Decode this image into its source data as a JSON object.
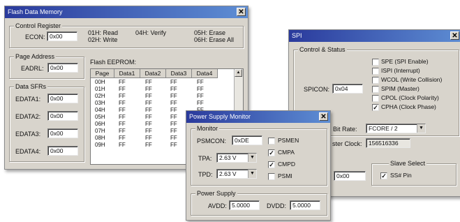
{
  "flash_window": {
    "title": "Flash Data Memory",
    "close_glyph": "✕",
    "control_register": {
      "group_label": "Control Register",
      "econ_label": "ECON:",
      "econ_value": "0x00",
      "legend_1": "01H: Read",
      "legend_2": "02H: Write",
      "legend_3": "04H: Verify",
      "legend_4": "05H: Erase",
      "legend_5": "06H: Erase All"
    },
    "page_address": {
      "group_label": "Page Address",
      "eadrl_label": "EADRL:",
      "eadrl_value": "0x00"
    },
    "data_sfrs": {
      "group_label": "Data SFRs",
      "items": [
        {
          "label": "EDATA1:",
          "value": "0x00"
        },
        {
          "label": "EDATA2:",
          "value": "0x00"
        },
        {
          "label": "EDATA3:",
          "value": "0x00"
        },
        {
          "label": "EDATA4:",
          "value": "0x00"
        }
      ]
    },
    "eeprom": {
      "label": "Flash EEPROM:",
      "columns": [
        "Page",
        "Data1",
        "Data2",
        "Data3",
        "Data4"
      ],
      "rows": [
        [
          "00H",
          "FF",
          "FF",
          "FF",
          "FF"
        ],
        [
          "01H",
          "FF",
          "FF",
          "FF",
          "FF"
        ],
        [
          "02H",
          "FF",
          "FF",
          "FF",
          "FF"
        ],
        [
          "03H",
          "FF",
          "FF",
          "FF",
          "FF"
        ],
        [
          "04H",
          "FF",
          "FF",
          "FF",
          "FF"
        ],
        [
          "05H",
          "FF",
          "FF",
          "FF",
          "FF"
        ],
        [
          "06H",
          "FF",
          "FF",
          "FF",
          "FF"
        ],
        [
          "07H",
          "FF",
          "FF",
          "FF",
          "FF"
        ],
        [
          "08H",
          "FF",
          "FF",
          "FF",
          "FF"
        ],
        [
          "09H",
          "FF",
          "FF",
          "FF",
          "FF"
        ]
      ],
      "scroll_up_glyph": "▲"
    }
  },
  "spi_window": {
    "title": "SPI",
    "close_glyph": "✕",
    "control_status": {
      "group_label": "Control & Status",
      "spicon_label": "SPICON:",
      "spicon_value": "0x04",
      "flags": [
        {
          "label": "SPE (SPI Enable)",
          "checked": false
        },
        {
          "label": "ISPI (Interrupt)",
          "checked": false
        },
        {
          "label": "WCOL (Write Collision)",
          "checked": false
        },
        {
          "label": "SPIM (Master)",
          "checked": false
        },
        {
          "label": "CPOL (Clock Polarity)",
          "checked": false
        },
        {
          "label": "CPHA (Clock Phase)",
          "checked": true
        }
      ]
    },
    "bit_rate_label": "I Bit Rate:",
    "bit_rate_value": "FCORE / 2",
    "master_clock_label": "ster Clock:",
    "master_clock_value": "156516336",
    "data_value": "0x00",
    "slave_select": {
      "group_label": "Slave Select",
      "ss_label": "SS# Pin",
      "ss_checked": true
    }
  },
  "psm_window": {
    "title": "Power Supply Monitor",
    "close_glyph": "✕",
    "monitor": {
      "group_label": "Monitor",
      "psmcon_label": "PSMCON:",
      "psmcon_value": "0xDE",
      "tpa_label": "TPA:",
      "tpa_value": "2.63 V",
      "tpd_label": "TPD:",
      "tpd_value": "2.63 V",
      "flags": [
        {
          "label": "PSMEN",
          "checked": false
        },
        {
          "label": "CMPA",
          "checked": true
        },
        {
          "label": "CMPD",
          "checked": true
        },
        {
          "label": "PSMI",
          "checked": false
        }
      ]
    },
    "power_supply": {
      "group_label": "Power Supply",
      "avdd_label": "AVDD:",
      "avdd_value": "5.0000",
      "dvdd_label": "DVDD:",
      "dvdd_value": "5.0000"
    }
  },
  "glyphs": {
    "check": "✓",
    "dropdown": "▼"
  }
}
